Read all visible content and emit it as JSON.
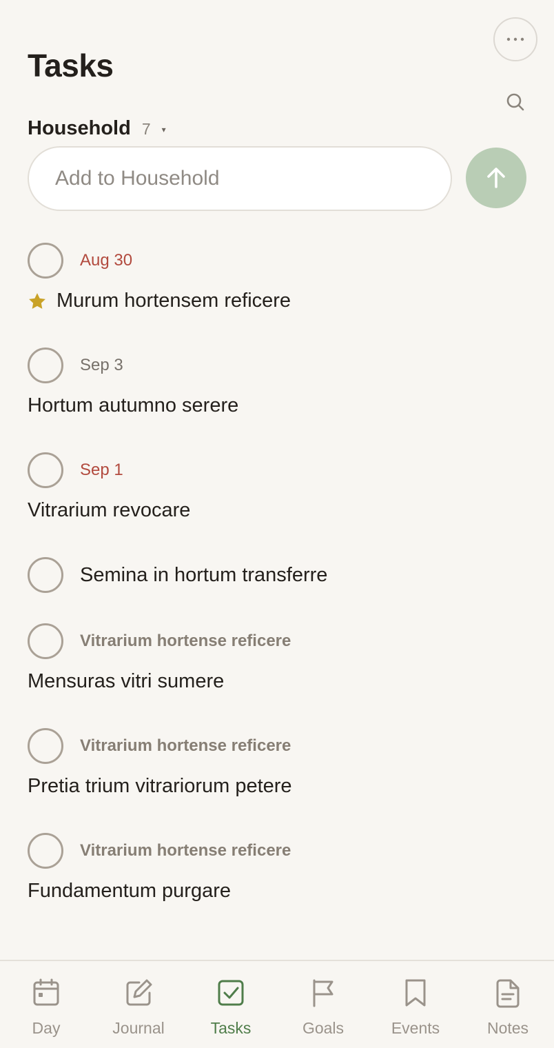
{
  "header": {
    "title": "Tasks",
    "more_icon": "ellipsis-icon",
    "search_icon": "search-icon"
  },
  "list": {
    "name": "Household",
    "count": "7",
    "caret": "▾"
  },
  "add": {
    "placeholder": "Add to Household",
    "submit_icon": "arrow-up-icon"
  },
  "tasks": [
    {
      "meta": "Aug 30",
      "meta_type": "overdue",
      "title": "Murum hortensem reficere",
      "starred": true
    },
    {
      "meta": "Sep 3",
      "meta_type": "future",
      "title": "Hortum autumno serere",
      "starred": false
    },
    {
      "meta": "Sep 1",
      "meta_type": "overdue",
      "title": "Vitrarium revocare",
      "starred": false
    },
    {
      "meta": "",
      "meta_type": "none",
      "title": "Semina in hortum transferre",
      "starred": false
    },
    {
      "meta": "Vitrarium hortense reficere",
      "meta_type": "project",
      "title": "Mensuras vitri sumere",
      "starred": false
    },
    {
      "meta": "Vitrarium hortense reficere",
      "meta_type": "project",
      "title": "Pretia trium vitrariorum petere",
      "starred": false
    },
    {
      "meta": "Vitrarium hortense reficere",
      "meta_type": "project",
      "title": "Fundamentum purgare",
      "starred": false
    }
  ],
  "nav": [
    {
      "label": "Day",
      "icon": "calendar-icon",
      "active": false
    },
    {
      "label": "Journal",
      "icon": "pencil-square-icon",
      "active": false
    },
    {
      "label": "Tasks",
      "icon": "checkbox-icon",
      "active": true
    },
    {
      "label": "Goals",
      "icon": "flag-icon",
      "active": false
    },
    {
      "label": "Events",
      "icon": "bookmark-icon",
      "active": false
    },
    {
      "label": "Notes",
      "icon": "document-icon",
      "active": false
    }
  ],
  "colors": {
    "background": "#f8f6f2",
    "accent_green": "#4f7d4a",
    "submit_green": "#b9cdb5",
    "overdue_red": "#b24a3e",
    "star_gold": "#c9a227"
  }
}
